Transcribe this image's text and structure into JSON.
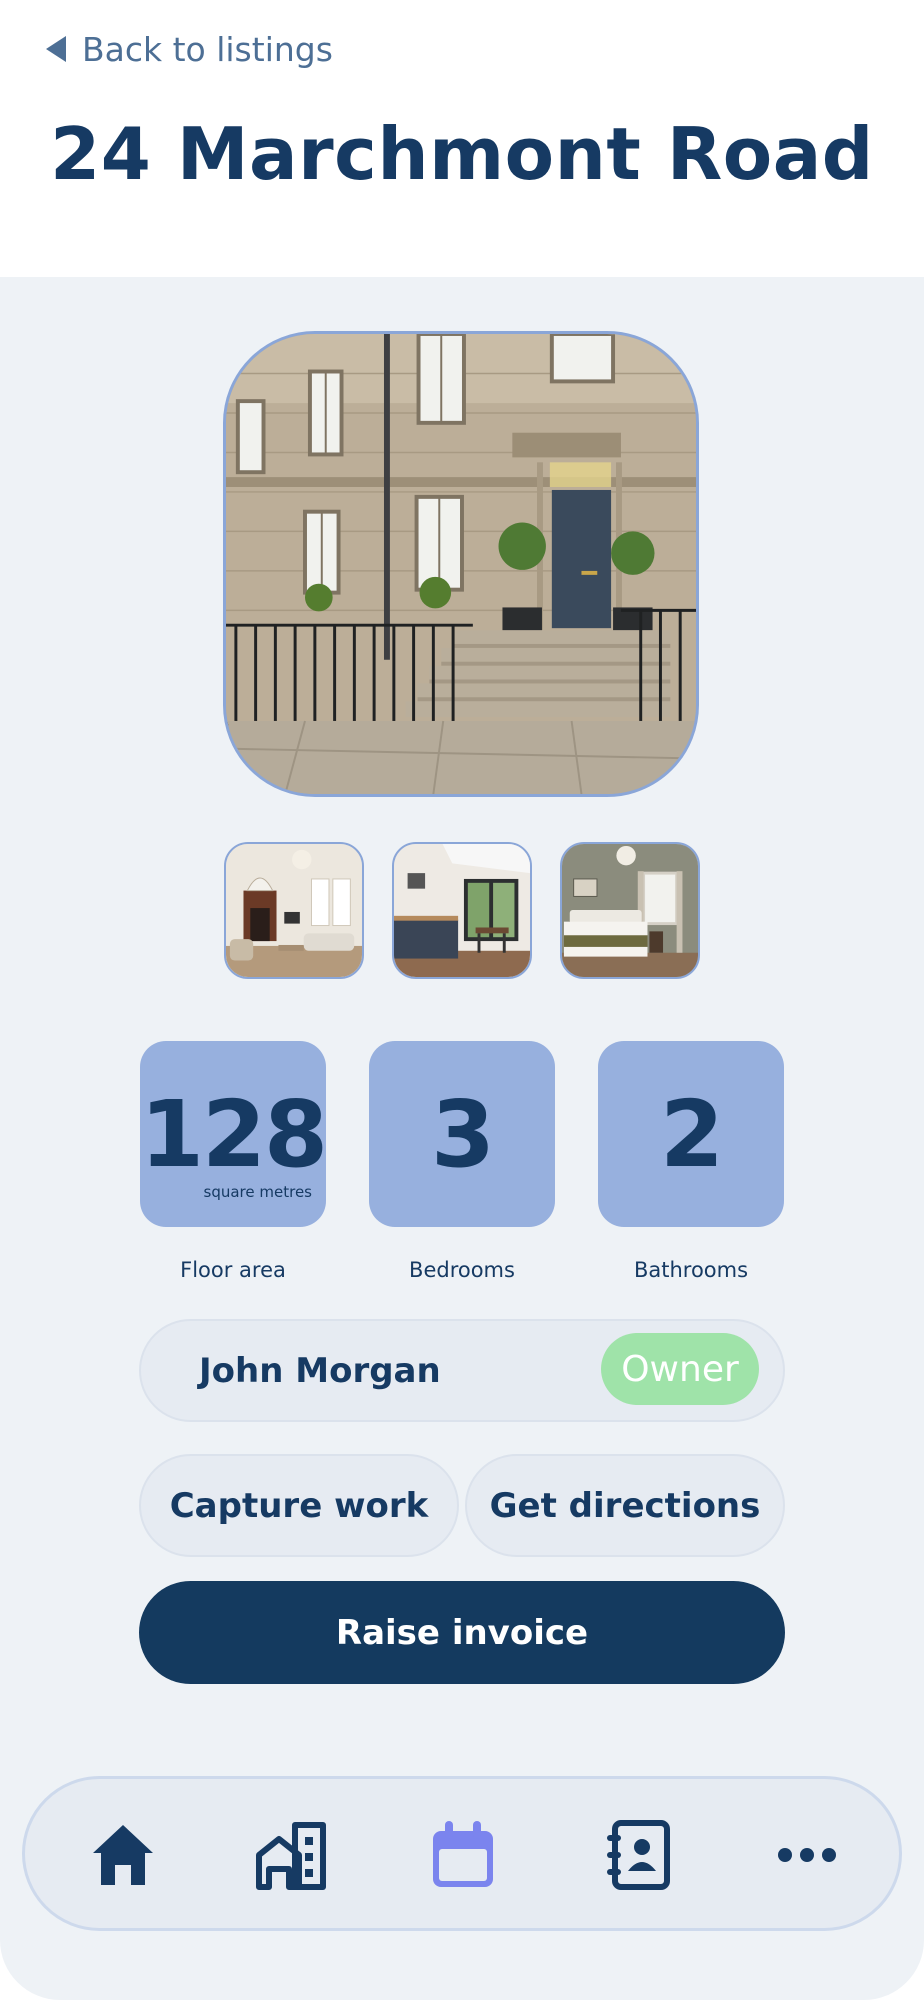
{
  "header": {
    "back_label": "Back to listings",
    "title": "24 Marchmont Road"
  },
  "stats": [
    {
      "value": "128",
      "unit": "square metres",
      "label": "Floor area"
    },
    {
      "value": "3",
      "label": "Bedrooms"
    },
    {
      "value": "2",
      "label": "Bathrooms"
    }
  ],
  "owner": {
    "name": "John Morgan",
    "role": "Owner"
  },
  "actions": {
    "capture": "Capture work",
    "directions": "Get directions",
    "primary": "Raise invoice"
  },
  "nav": [
    {
      "icon": "home-icon"
    },
    {
      "icon": "buildings-icon"
    },
    {
      "icon": "calendar-icon",
      "active": true
    },
    {
      "icon": "contacts-icon"
    },
    {
      "icon": "more-icon"
    }
  ],
  "colors": {
    "primary": "#143a5f",
    "accent": "#97b0de",
    "badge": "#9fe3a9",
    "active_nav": "#7b84ee"
  }
}
